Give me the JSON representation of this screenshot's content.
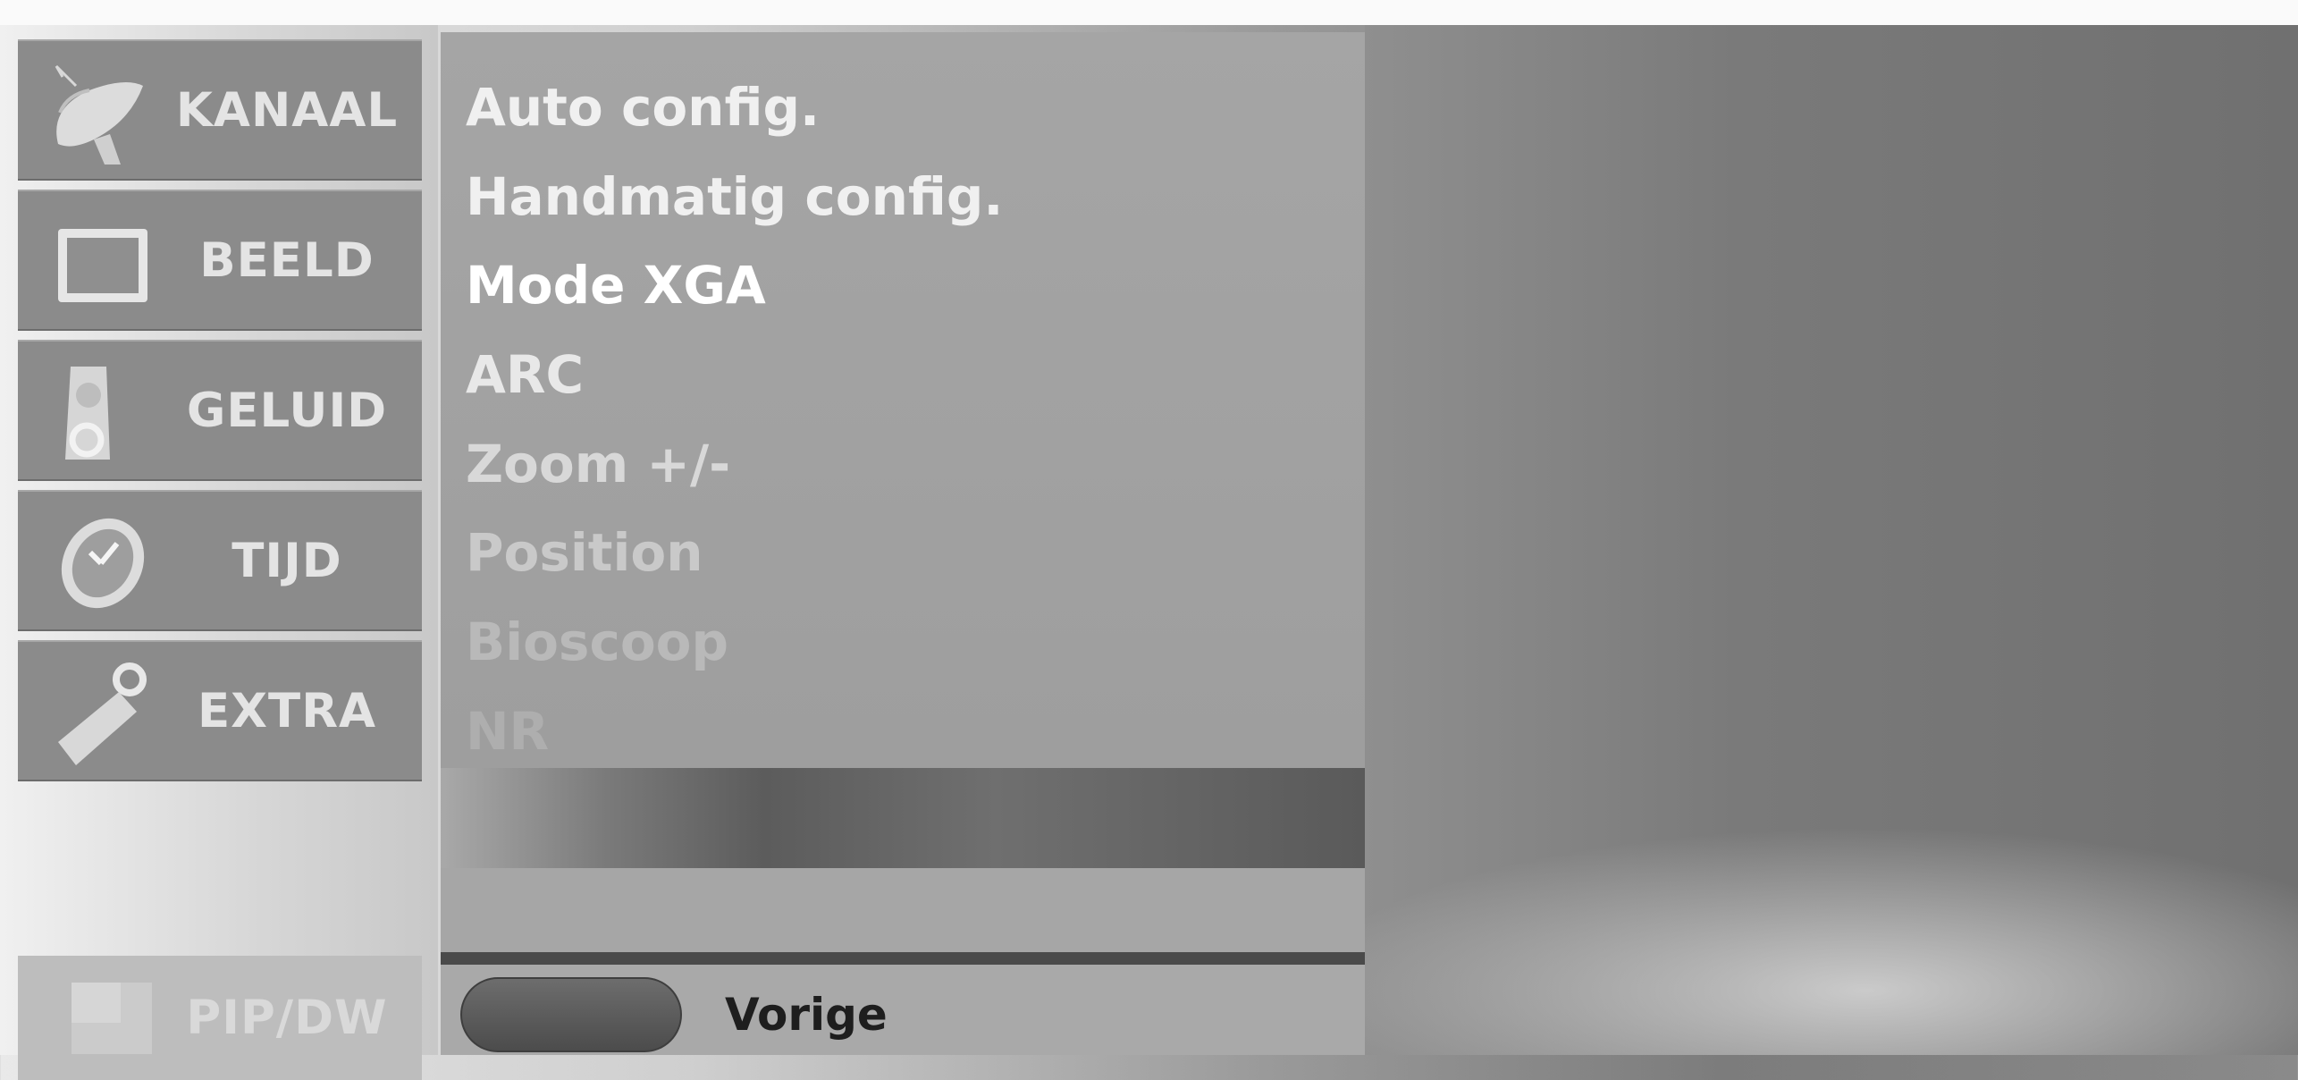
{
  "sidebar": {
    "items": [
      {
        "label": "KANAAL",
        "icon": "satellite-dish-icon"
      },
      {
        "label": "BEELD",
        "icon": "monitor-icon"
      },
      {
        "label": "GELUID",
        "icon": "speaker-icon"
      },
      {
        "label": "TIJD",
        "icon": "clock-icon"
      },
      {
        "label": "EXTRA",
        "icon": "tag-icon"
      }
    ],
    "pip": {
      "label": "PIP/DW",
      "icon": "pip-icon"
    }
  },
  "menu": {
    "items": [
      {
        "label": "Auto config.",
        "color": "#f0f0f0"
      },
      {
        "label": "Handmatig config.",
        "color": "#f0f0f0"
      },
      {
        "label": "Mode XGA",
        "color": "#ffffff"
      },
      {
        "label": "ARC",
        "color": "#e8e8e8"
      },
      {
        "label": "Zoom +/-",
        "color": "#d8d8d8"
      },
      {
        "label": "Position",
        "color": "#c9c9c9"
      },
      {
        "label": "Bioscoop",
        "color": "#b9b9b9"
      },
      {
        "label": "NR",
        "color": "#aeaeae"
      }
    ]
  },
  "footer": {
    "back_label": "Vorige"
  }
}
